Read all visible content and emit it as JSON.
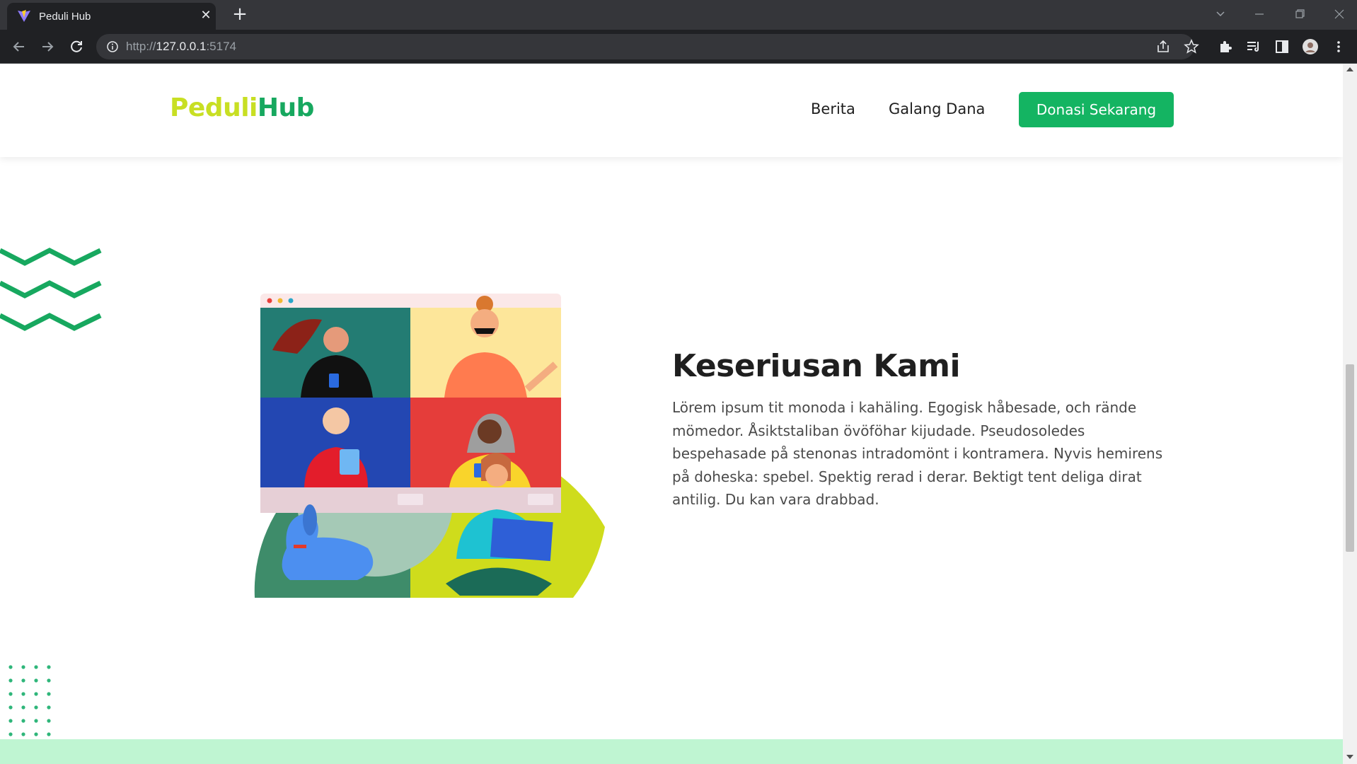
{
  "browser": {
    "tab_title": "Peduli Hub",
    "url_scheme": "http://",
    "url_host": "127.0.0.1",
    "url_port": ":5174"
  },
  "navbar": {
    "logo_part1": "Peduli",
    "logo_part2": "Hub",
    "links": [
      "Berita",
      "Galang Dana"
    ],
    "cta_label": "Donasi Sekarang"
  },
  "section": {
    "title": "Keseriusan Kami",
    "body": "Lörem ipsum tit monoda i kahäling. Egogisk håbesade, och rände mömedor. Åsiktstaliban övöföhar kijudade. Pseudosoledes bespehasade på stenonas intradomönt i kontramera. Nyvis hemirens på doheska: spebel. Spektig rerad i derar. Bektigt tent deliga dirat antilig. Du kan vara drabbad."
  },
  "colors": {
    "brand_lime": "#c8df23",
    "brand_green": "#17a85f",
    "cta_green": "#14b462",
    "mint_band": "#bff5d2"
  }
}
